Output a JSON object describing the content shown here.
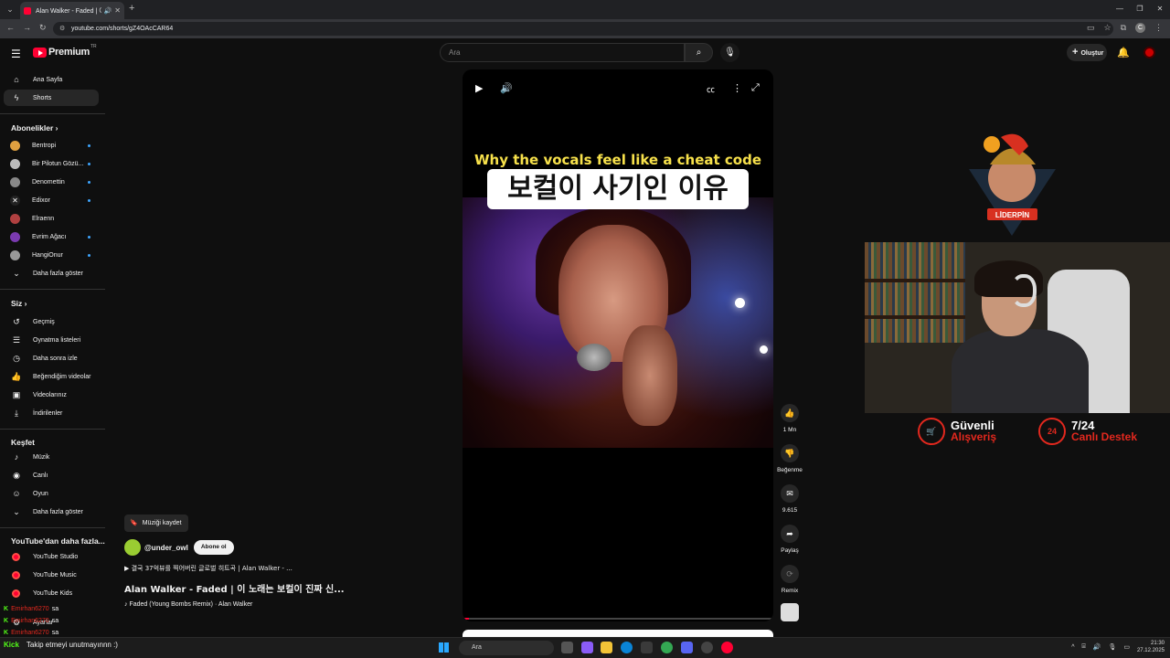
{
  "browser": {
    "tab_title": "Alan Walker - Faded | 이 노",
    "url": "youtube.com/shorts/gZ4OAcCAR64",
    "profile_initial": "C"
  },
  "masthead": {
    "logo_text": "Premium",
    "country": "TR",
    "search_placeholder": "Ara",
    "create_label": "Oluştur"
  },
  "sidebar": {
    "top": [
      {
        "label": "Ana Sayfa",
        "icon": "home-icon"
      },
      {
        "label": "Shorts",
        "icon": "shorts-icon"
      }
    ],
    "subs_header": "Abonelikler",
    "subs": [
      {
        "label": "Bentropi",
        "color": "#e0a040"
      },
      {
        "label": "Bir Pilotun Gözü...",
        "color": "#bbbbbb"
      },
      {
        "label": "Denomettin",
        "color": "#888888"
      },
      {
        "label": "Edixor",
        "color": "#222222"
      },
      {
        "label": "Elraenn",
        "color": "#b04040"
      },
      {
        "label": "Evrim Ağacı",
        "color": "#7a3ab0"
      },
      {
        "label": "HangiOnur",
        "color": "#999999"
      }
    ],
    "more_subs": "Daha fazla göster",
    "you_header": "Siz",
    "you": [
      {
        "label": "Geçmiş",
        "icon": "history-icon"
      },
      {
        "label": "Oynatma listeleri",
        "icon": "playlists-icon"
      },
      {
        "label": "Daha sonra izle",
        "icon": "watch-later-icon"
      },
      {
        "label": "Beğendiğim videolar",
        "icon": "liked-icon"
      },
      {
        "label": "Videolarınız",
        "icon": "your-videos-icon"
      },
      {
        "label": "İndirilenler",
        "icon": "downloads-icon"
      }
    ],
    "explore_header": "Keşfet",
    "explore": [
      {
        "label": "Müzik",
        "icon": "music-icon"
      },
      {
        "label": "Canlı",
        "icon": "live-icon"
      },
      {
        "label": "Oyun",
        "icon": "gaming-icon"
      }
    ],
    "more_explore": "Daha fazla göster",
    "more_yt_header": "YouTube'dan daha fazla...",
    "more_yt": [
      {
        "label": "YouTube Studio"
      },
      {
        "label": "YouTube Music"
      },
      {
        "label": "YouTube Kids"
      }
    ],
    "settings": "Ayarlar"
  },
  "short": {
    "caption_en": "Why the vocals feel like a cheat code",
    "caption_ko": "보컬이 사기인 이유",
    "progress": 0.02,
    "save_music": "Müziği kaydet",
    "channel": "@under_owl",
    "subscribe": "Abone ol",
    "description": "▶ 결국 37억뷰를 찍어버린 글로벌 히트곡 | Alan Walker - ...",
    "title": "Alan Walker - Faded | 이 노래는 보컬이 진짜 신...",
    "music": "♪ Faded (Young Bombs Remix) · Alan Walker"
  },
  "actions": {
    "like_count": "1 Mn",
    "dislike": "Beğenme",
    "comments": "9.615",
    "share": "Paylaş",
    "remix": "Remix"
  },
  "overlay": {
    "brand": "LİDERPİN",
    "promo1_top": "Güvenli",
    "promo1_bottom": "Alışveriş",
    "promo2_top": "7/24",
    "promo2_bottom": "Canlı Destek",
    "promo2_badge": "24",
    "chat": [
      {
        "user": "Emirhan6270",
        "msg": "sa"
      },
      {
        "user": "Emirhan6270",
        "msg": "sa"
      },
      {
        "user": "Emirhan6270",
        "msg": "sa"
      }
    ],
    "follow_note": "Takip etmeyi unutmayınnn :)",
    "kick_label": "Kick"
  },
  "taskbar": {
    "search": "Ara",
    "time": "21:30",
    "date": "27.12.2025"
  }
}
